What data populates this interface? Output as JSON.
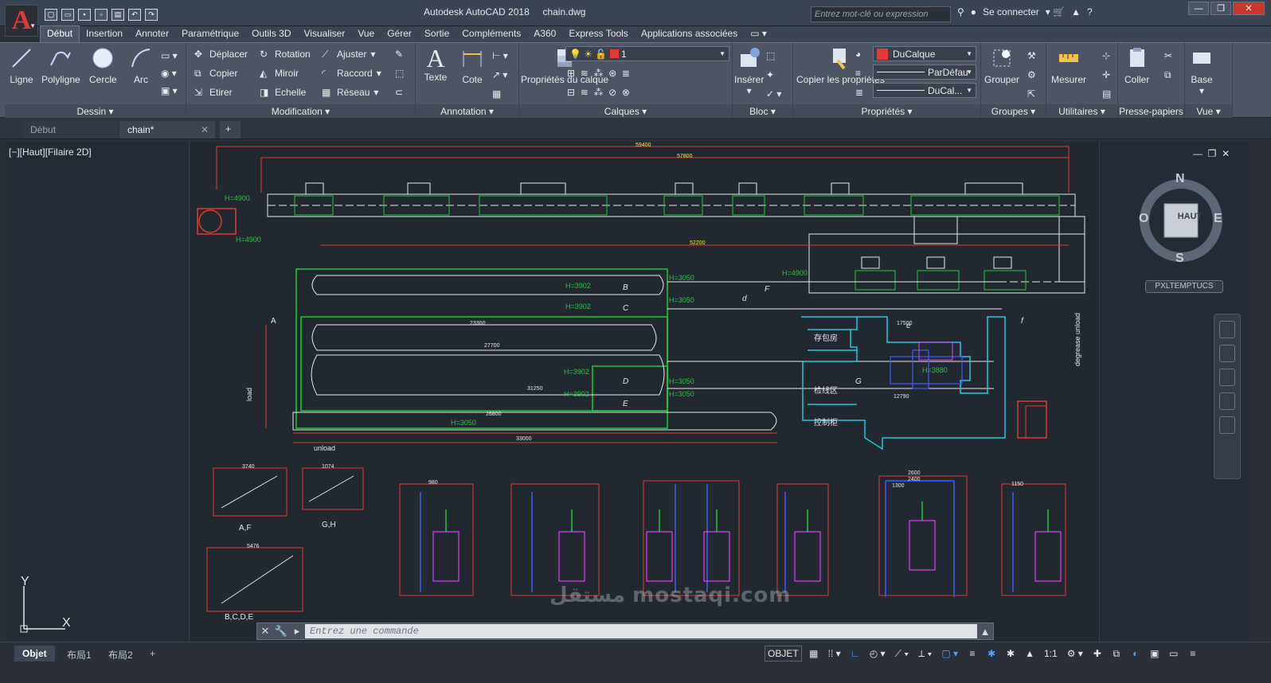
{
  "app": {
    "title": "Autodesk AutoCAD 2018",
    "file": "chain.dwg",
    "search_placeholder": "Entrez mot-clé ou expression",
    "connect_label": "Se connecter",
    "help_label": "?"
  },
  "ribbon_tabs": [
    "Début",
    "Insertion",
    "Annoter",
    "Paramétrique",
    "Outils 3D",
    "Visualiser",
    "Vue",
    "Gérer",
    "Sortie",
    "Compléments",
    "A360",
    "Express Tools",
    "Applications associées"
  ],
  "panels": {
    "dessin": {
      "title": "Dessin",
      "tools": [
        "Ligne",
        "Polyligne",
        "Cercle",
        "Arc"
      ]
    },
    "modification": {
      "title": "Modification",
      "tools": [
        "Déplacer",
        "Rotation",
        "Ajuster",
        "Copier",
        "Miroir",
        "Raccord",
        "Etirer",
        "Echelle",
        "Réseau"
      ]
    },
    "annotation": {
      "title": "Annotation",
      "tools": [
        "Texte",
        "Cote"
      ]
    },
    "calques": {
      "title": "Calques",
      "layer_props": "Propriétés du calque",
      "current_layer": "1"
    },
    "bloc": {
      "title": "Bloc",
      "insert": "Insérer"
    },
    "proprietes": {
      "title": "Propriétés",
      "copy_props": "Copier les propriétés",
      "color": "DuCalque",
      "linetype": "ParDéfau",
      "lineweight": "DuCal..."
    },
    "groupes": {
      "title": "Groupes",
      "group": "Grouper"
    },
    "utilitaires": {
      "title": "Utilitaires",
      "measure": "Mesurer"
    },
    "presse_papiers": {
      "title": "Presse-papiers",
      "paste": "Coller"
    },
    "vue": {
      "title": "Vue",
      "base": "Base"
    }
  },
  "doc_tabs": {
    "start": "Début",
    "current": "chain*"
  },
  "viewport": {
    "label": "[−][Haut][Filaire 2D]",
    "wcs": "PXLTEMPTUCS"
  },
  "viewcube": {
    "n": "N",
    "s": "S",
    "e": "E",
    "w": "O",
    "face": "HAUT"
  },
  "ucs": {
    "x": "X",
    "y": "Y"
  },
  "command": {
    "placeholder": "Entrez une commande"
  },
  "layouts": [
    "Objet",
    "布局1",
    "布局2"
  ],
  "status": {
    "mode": "OBJET",
    "scale": "1:1"
  },
  "watermark": "مستقل mostaqi.com",
  "drawing_text": {
    "top_dims": [
      "59400",
      "57800"
    ],
    "h_labels": [
      "H=4900",
      "H=4900",
      "H=4900",
      "H=3902",
      "H=3902",
      "H=3050",
      "H=3050",
      "H=3902",
      "H=3902",
      "H=3050",
      "H=3050",
      "H=3050",
      "H=3880",
      "H=4900"
    ],
    "dims_mid": [
      "52200",
      "23300",
      "27700",
      "31250",
      "26800",
      "33000",
      "17500",
      "12790"
    ],
    "letters": [
      "A",
      "B",
      "C",
      "D",
      "E",
      "F",
      "G",
      "d",
      "e",
      "f"
    ],
    "cn_labels": [
      "存包房",
      "检线区",
      "控制柜"
    ],
    "side_labels": [
      "load",
      "unload",
      "degrease unload"
    ],
    "section_labels": [
      "A,F",
      "G,H",
      "B,C,D,E"
    ],
    "detail_dims": [
      "3740",
      "1074",
      "5476",
      "2600",
      "2400",
      "1300",
      "1150",
      "980"
    ]
  },
  "colors": {
    "accent": "#e53935",
    "bg": "#212830",
    "ribbon": "#4d5565"
  }
}
